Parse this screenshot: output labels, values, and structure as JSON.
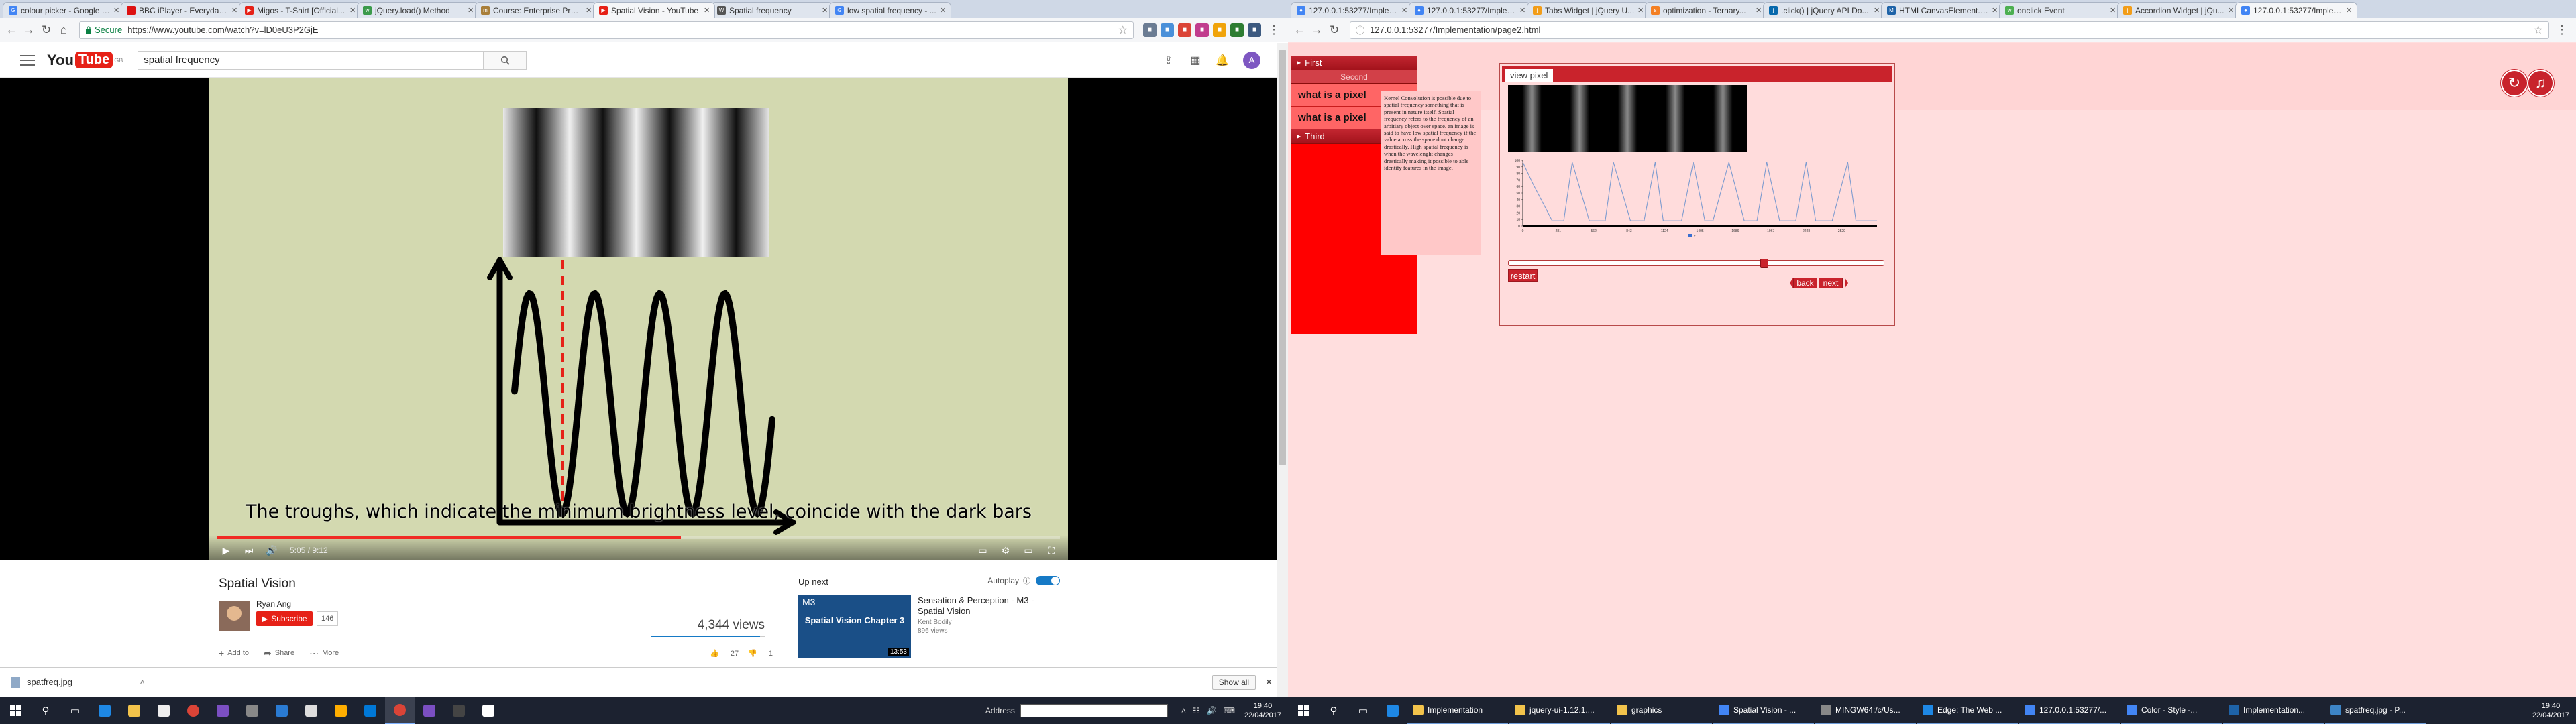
{
  "left": {
    "tabs": [
      {
        "title": "colour picker - Google Se...",
        "color": "#4285f4",
        "glyph": "G"
      },
      {
        "title": "BBC iPlayer - Everyday Mi...",
        "color": "#d11",
        "glyph": "i"
      },
      {
        "title": "Migos - T-Shirt [Official...",
        "color": "#e62117",
        "glyph": "▶"
      },
      {
        "title": "jQuery.load() Method",
        "color": "#3b9a4b",
        "glyph": "w"
      },
      {
        "title": "Course: Enterprise Progr...",
        "color": "#a97f3a",
        "glyph": "m"
      },
      {
        "title": "Spatial Vision - YouTube",
        "color": "#e62117",
        "glyph": "▶",
        "active": true
      },
      {
        "title": "Spatial frequency",
        "color": "#555",
        "glyph": "W"
      },
      {
        "title": "low spatial frequency - ...",
        "color": "#4285f4",
        "glyph": "G"
      }
    ],
    "url_secure": "Secure",
    "url": "https://www.youtube.com/watch?v=lD0eU3P2GjE",
    "logo": {
      "you": "You",
      "tube": "Tube",
      "region": "GB"
    },
    "search_value": "spatial frequency",
    "avatar_letter": "A",
    "caption": "The troughs, which indicate the minimum brightness level, coincide with the dark bars",
    "time": "5:05 / 9:12",
    "progress": 0.55,
    "video_title": "Spatial Vision",
    "channel": "Ryan Ang",
    "subscribe": "Subscribe",
    "sub_count": "146",
    "views": "4,344 views",
    "actions": {
      "add": "Add to",
      "share": "Share",
      "more": "More",
      "likes": "27",
      "dislikes": "1"
    },
    "upnext": {
      "header": "Up next",
      "autoplay": "Autoplay",
      "thumb_badge": "M3",
      "thumb_title": "Spatial Vision Chapter 3",
      "duration": "13:53",
      "title": "Sensation & Perception - M3 - Spatial Vision",
      "author": "Kent Bodily",
      "views": "896 views"
    },
    "download": {
      "file": "spatfreq.jpg",
      "show_all": "Show all"
    },
    "taskbar": {
      "address_label": "Address",
      "time": "19:40",
      "date": "22/04/2017"
    }
  },
  "right": {
    "tabs": [
      {
        "title": "127.0.0.1:53277/Implem...",
        "color": "#4285f4",
        "glyph": "●"
      },
      {
        "title": "127.0.0.1:53277/Implem...",
        "color": "#4285f4",
        "glyph": "●"
      },
      {
        "title": "Tabs Widget | jQuery U...",
        "color": "#f29d19",
        "glyph": "j"
      },
      {
        "title": "optimization - Ternary...",
        "color": "#f48024",
        "glyph": "s"
      },
      {
        "title": ".click() | jQuery API Do...",
        "color": "#0769ad",
        "glyph": "j"
      },
      {
        "title": "HTMLCanvasElement.t...",
        "color": "#1e63a8",
        "glyph": "M"
      },
      {
        "title": "onclick Event",
        "color": "#4caf50",
        "glyph": "w"
      },
      {
        "title": "Accordion Widget | jQu...",
        "color": "#f29d19",
        "glyph": "j"
      },
      {
        "title": "127.0.0.1:53277/Implem...",
        "color": "#4285f4",
        "glyph": "●",
        "active": true
      }
    ],
    "url": "127.0.0.1:53277/Implementation/page2.html",
    "menu": {
      "first": "First",
      "second": "Second",
      "item1": "what is a pixel",
      "item2": "what is a pixel",
      "third": "Third"
    },
    "text": "Kernel Convolution is possible due to spatial frequency something that is present in nature itself. Spatial frequency refers to the frequency of an arbitiary object over space. an image is said to have low spatial frequency if the value across the space dont change drastically. High spatial frequency is when the wavelenght changes drastically making it possible to able identify features in the image.",
    "tab_label": "view pixel",
    "restart": "restart",
    "back": "back",
    "next": "next",
    "slider_value": 0.68,
    "chart_data": {
      "type": "line",
      "ylim": [
        0,
        100
      ],
      "yticks": [
        0,
        10,
        20,
        30,
        40,
        50,
        60,
        70,
        80,
        90,
        100
      ],
      "xlim": [
        0,
        2809
      ],
      "xticks": [
        0,
        281,
        562,
        843,
        1124,
        1405,
        1686,
        1967,
        2248,
        2529
      ],
      "legend_label": "x",
      "series": [
        {
          "name": "x",
          "x": [
            0,
            81,
            233,
            325,
            392,
            527,
            654,
            719,
            854,
            962,
            1050,
            1114,
            1259,
            1352,
            1444,
            1508,
            1635,
            1756,
            1857,
            1935,
            2037,
            2165,
            2247,
            2323,
            2454,
            2577,
            2642,
            2717,
            2809
          ],
          "y": [
            97,
            64,
            8,
            8,
            97,
            8,
            8,
            97,
            8,
            8,
            97,
            8,
            8,
            97,
            8,
            8,
            97,
            8,
            8,
            97,
            8,
            8,
            97,
            8,
            8,
            97,
            8,
            8,
            8
          ]
        }
      ]
    },
    "taskbar": {
      "apps": [
        {
          "label": "Implementation",
          "color": "#f2c34b"
        },
        {
          "label": "jquery-ui-1.12.1....",
          "color": "#f2c34b"
        },
        {
          "label": "graphics",
          "color": "#f2c34b"
        },
        {
          "label": "Spatial Vision - ...",
          "color": "#4285f4"
        },
        {
          "label": "MINGW64:/c/Us...",
          "color": "#888"
        },
        {
          "label": "Edge: The Web ...",
          "color": "#1e88e5"
        },
        {
          "label": "127.0.0.1:53277/...",
          "color": "#4285f4"
        },
        {
          "label": "Color - Style -...",
          "color": "#4285f4"
        },
        {
          "label": "Implementation...",
          "color": "#1e63a8"
        },
        {
          "label": "spatfreq.jpg - P...",
          "color": "#3d85c6"
        }
      ],
      "time": "19:40",
      "date": "22/04/2017"
    }
  }
}
